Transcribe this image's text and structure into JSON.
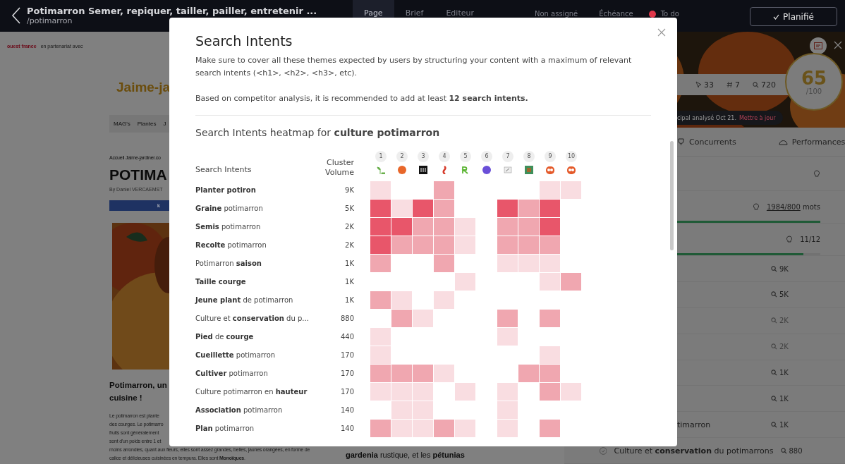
{
  "top_bar": {
    "title": "Potimarron Semer, repiquer, tailler, pailler, entretenir ...",
    "path": "/potimarron",
    "tabs": [
      {
        "label": "Page",
        "selected": true
      },
      {
        "label": "Brief",
        "selected": false
      },
      {
        "label": "Editeur",
        "selected": false
      }
    ],
    "assignee": "Non assigné",
    "due": "Échéance",
    "status": {
      "label": "To do",
      "color": "#e0374a"
    },
    "action": "Planifié"
  },
  "article": {
    "partner_logo": "ouest france",
    "partner": "en partenariat avec",
    "logo": "Jaime-ja",
    "nav": [
      "MAG's",
      "Plantes",
      "J"
    ],
    "breadcrumb": "Accueil Jaime-jardiner.co",
    "title": "POTIMA",
    "byline": "By Daniel VERCAEMST",
    "share": "k",
    "heading": "Potimarron, un",
    "heading_2": "cuisine !",
    "paragraph": [
      "Le potimarron est plante",
      "des courges. Le potimarro",
      "fruits sont généralement",
      "sont d'un poids entre 1 et",
      "moins arrondies, quant aux fleurs, elles sont assez grandes, belles, jaunes orangées, en forme de",
      "calice et délicieuses cuisinées en tempura. Elles sont **Monoïques**."
    ],
    "side_text": "**gardenia** rustique, et les **pétunias**"
  },
  "right_panel": {
    "stats": [
      "33",
      "7",
      "720"
    ],
    "score": "65",
    "score_max": "/100",
    "notice": "cipal analysé Oct 21.",
    "notice_link": "Mettre à jour",
    "tabs": [
      "Concurrents",
      "Performances"
    ],
    "word_count": {
      "value": "1984/800",
      "unit": "mots",
      "level": 1
    },
    "intents_count": {
      "value": "11/12",
      "level": 0.88
    },
    "rows": [
      {
        "label": "",
        "volume": "9K",
        "muted": false
      },
      {
        "label": "",
        "volume": "5K",
        "muted": false
      },
      {
        "label": "",
        "volume": "2K",
        "muted": true
      },
      {
        "label": "",
        "volume": "2K",
        "muted": true
      },
      {
        "label": "",
        "volume": "1K",
        "muted": false
      },
      {
        "label": "",
        "volume": "1K",
        "muted": false
      },
      {
        "label": "timarron",
        "volume": "1K",
        "muted": false
      },
      {
        "label": "Culture et **conservation** du potimarrons",
        "volume": "880",
        "muted": false
      }
    ]
  },
  "modal": {
    "title": "Search Intents",
    "description": "Make sure to cover all these themes expected by users by structuring your content with a maximum of relevant search intents (<h1>, <h2>, <h3>, etc).",
    "recommendation": "Based on competitor analysis, it is recommended to add at least **12 search intents.**",
    "heatmap": {
      "title": "Search Intents heatmap for **culture potimarron**",
      "columns": [
        "Search Intents",
        "Cluster Volume"
      ],
      "competitors": [
        "1",
        "2",
        "3",
        "4",
        "5",
        "6",
        "7",
        "8",
        "9",
        "10"
      ],
      "rows": [
        {
          "label": "**Planter potiron**",
          "volume": "9K",
          "cells": [
            {
              "color": "#f9dde1"
            },
            {
              "color": "#ffffff"
            },
            {
              "color": "#ffffff"
            },
            {
              "color": "#f0a7b0"
            },
            {
              "color": "#ffffff"
            },
            {
              "color": "#ffffff"
            },
            {
              "color": "#ffffff"
            },
            {
              "color": "#ffffff"
            },
            {
              "color": "#f9dde1"
            },
            {
              "color": "#f9dde1"
            }
          ]
        },
        {
          "label": "**Graine** potimarron",
          "volume": "5K",
          "cells": [
            {
              "color": "#e8566a"
            },
            {
              "color": "#f9dde1"
            },
            {
              "color": "#e8566a"
            },
            {
              "color": "#f0a7b0"
            },
            {
              "color": "#ffffff"
            },
            {
              "color": "#ffffff"
            },
            {
              "color": "#e8566a"
            },
            {
              "color": "#f0a7b0"
            },
            {
              "color": "#e8566a"
            },
            {
              "color": "#ffffff"
            }
          ]
        },
        {
          "label": "**Semis** potimarron",
          "volume": "2K",
          "cells": [
            {
              "color": "#e8566a"
            },
            {
              "color": "#e8566a"
            },
            {
              "color": "#f0a7b0"
            },
            {
              "color": "#f0a7b0"
            },
            {
              "color": "#f9dde1"
            },
            {
              "color": "#ffffff"
            },
            {
              "color": "#f0a7b0"
            },
            {
              "color": "#f0a7b0"
            },
            {
              "color": "#e8566a"
            },
            {
              "color": "#ffffff"
            }
          ]
        },
        {
          "label": "**Recolte** potimarron",
          "volume": "2K",
          "cells": [
            {
              "color": "#e8566a"
            },
            {
              "color": "#f0a7b0"
            },
            {
              "color": "#f0a7b0"
            },
            {
              "color": "#f0a7b0"
            },
            {
              "color": "#f9dde1"
            },
            {
              "color": "#ffffff"
            },
            {
              "color": "#f0a7b0"
            },
            {
              "color": "#f0a7b0"
            },
            {
              "color": "#f0a7b0"
            },
            {
              "color": "#ffffff"
            }
          ]
        },
        {
          "label": "Potimarron **saison**",
          "volume": "1K",
          "cells": [
            {
              "color": "#f0a7b0"
            },
            {
              "color": "#ffffff"
            },
            {
              "color": "#ffffff"
            },
            {
              "color": "#f0a7b0"
            },
            {
              "color": "#ffffff"
            },
            {
              "color": "#ffffff"
            },
            {
              "color": "#f9dde1"
            },
            {
              "color": "#f9dde1"
            },
            {
              "color": "#f9dde1"
            },
            {
              "color": "#ffffff"
            }
          ]
        },
        {
          "label": "**Taille courge**",
          "volume": "1K",
          "cells": [
            {
              "color": "#ffffff"
            },
            {
              "color": "#ffffff"
            },
            {
              "color": "#ffffff"
            },
            {
              "color": "#ffffff"
            },
            {
              "color": "#f9dde1"
            },
            {
              "color": "#ffffff"
            },
            {
              "color": "#ffffff"
            },
            {
              "color": "#ffffff"
            },
            {
              "color": "#f9dde1"
            },
            {
              "color": "#f0a7b0"
            }
          ]
        },
        {
          "label": "**Jeune plant** de potimarron",
          "volume": "1K",
          "cells": [
            {
              "color": "#f0a7b0"
            },
            {
              "color": "#f9dde1"
            },
            {
              "color": "#ffffff"
            },
            {
              "color": "#f9dde1"
            },
            {
              "color": "#ffffff"
            },
            {
              "color": "#ffffff"
            },
            {
              "color": "#ffffff"
            },
            {
              "color": "#ffffff"
            },
            {
              "color": "#ffffff"
            },
            {
              "color": "#ffffff"
            }
          ]
        },
        {
          "label": "Culture et **conservation** du p...",
          "volume": "880",
          "cells": [
            {
              "color": "#ffffff"
            },
            {
              "color": "#f0a7b0"
            },
            {
              "color": "#f9dde1"
            },
            {
              "color": "#ffffff"
            },
            {
              "color": "#ffffff"
            },
            {
              "color": "#ffffff"
            },
            {
              "color": "#f0a7b0"
            },
            {
              "color": "#ffffff"
            },
            {
              "color": "#f0a7b0"
            },
            {
              "color": "#ffffff"
            }
          ]
        },
        {
          "label": "**Pied** de **courge**",
          "volume": "440",
          "cells": [
            {
              "color": "#f9dde1"
            },
            {
              "color": "#ffffff"
            },
            {
              "color": "#ffffff"
            },
            {
              "color": "#ffffff"
            },
            {
              "color": "#ffffff"
            },
            {
              "color": "#ffffff"
            },
            {
              "color": "#f9dde1"
            },
            {
              "color": "#ffffff"
            },
            {
              "color": "#ffffff"
            },
            {
              "color": "#ffffff"
            }
          ]
        },
        {
          "label": "**Cueillette** potimarron",
          "volume": "170",
          "cells": [
            {
              "color": "#f9dde1"
            },
            {
              "color": "#ffffff"
            },
            {
              "color": "#ffffff"
            },
            {
              "color": "#ffffff"
            },
            {
              "color": "#ffffff"
            },
            {
              "color": "#ffffff"
            },
            {
              "color": "#ffffff"
            },
            {
              "color": "#ffffff"
            },
            {
              "color": "#f9dde1"
            },
            {
              "color": "#ffffff"
            }
          ]
        },
        {
          "label": "**Cultiver** potimarron",
          "volume": "170",
          "cells": [
            {
              "color": "#f0a7b0"
            },
            {
              "color": "#f0a7b0"
            },
            {
              "color": "#f0a7b0"
            },
            {
              "color": "#f9dde1"
            },
            {
              "color": "#ffffff"
            },
            {
              "color": "#ffffff"
            },
            {
              "color": "#ffffff"
            },
            {
              "color": "#f0a7b0"
            },
            {
              "color": "#f0a7b0"
            },
            {
              "color": "#ffffff"
            }
          ]
        },
        {
          "label": "Culture potimarron en **hauteur**",
          "volume": "170",
          "cells": [
            {
              "color": "#f9dde1"
            },
            {
              "color": "#f9dde1"
            },
            {
              "color": "#f9dde1"
            },
            {
              "color": "#ffffff"
            },
            {
              "color": "#f9dde1"
            },
            {
              "color": "#ffffff"
            },
            {
              "color": "#f9dde1"
            },
            {
              "color": "#ffffff"
            },
            {
              "color": "#f0a7b0"
            },
            {
              "color": "#f9dde1"
            }
          ]
        },
        {
          "label": "**Association** potimarron",
          "volume": "140",
          "cells": [
            {
              "color": "#ffffff"
            },
            {
              "color": "#f9dde1"
            },
            {
              "color": "#f9dde1"
            },
            {
              "color": "#ffffff"
            },
            {
              "color": "#ffffff"
            },
            {
              "color": "#ffffff"
            },
            {
              "color": "#f9dde1"
            },
            {
              "color": "#ffffff"
            },
            {
              "color": "#ffffff"
            },
            {
              "color": "#ffffff"
            }
          ]
        },
        {
          "label": "**Plan** potimarron",
          "volume": "140",
          "cells": [
            {
              "color": "#f0a7b0"
            },
            {
              "color": "#f9dde1"
            },
            {
              "color": "#f9dde1"
            },
            {
              "color": "#f0a7b0"
            },
            {
              "color": "#f9dde1"
            },
            {
              "color": "#ffffff"
            },
            {
              "color": "#f9dde1"
            },
            {
              "color": "#ffffff"
            },
            {
              "color": "#f0a7b0"
            },
            {
              "color": "#ffffff"
            }
          ]
        }
      ]
    }
  }
}
